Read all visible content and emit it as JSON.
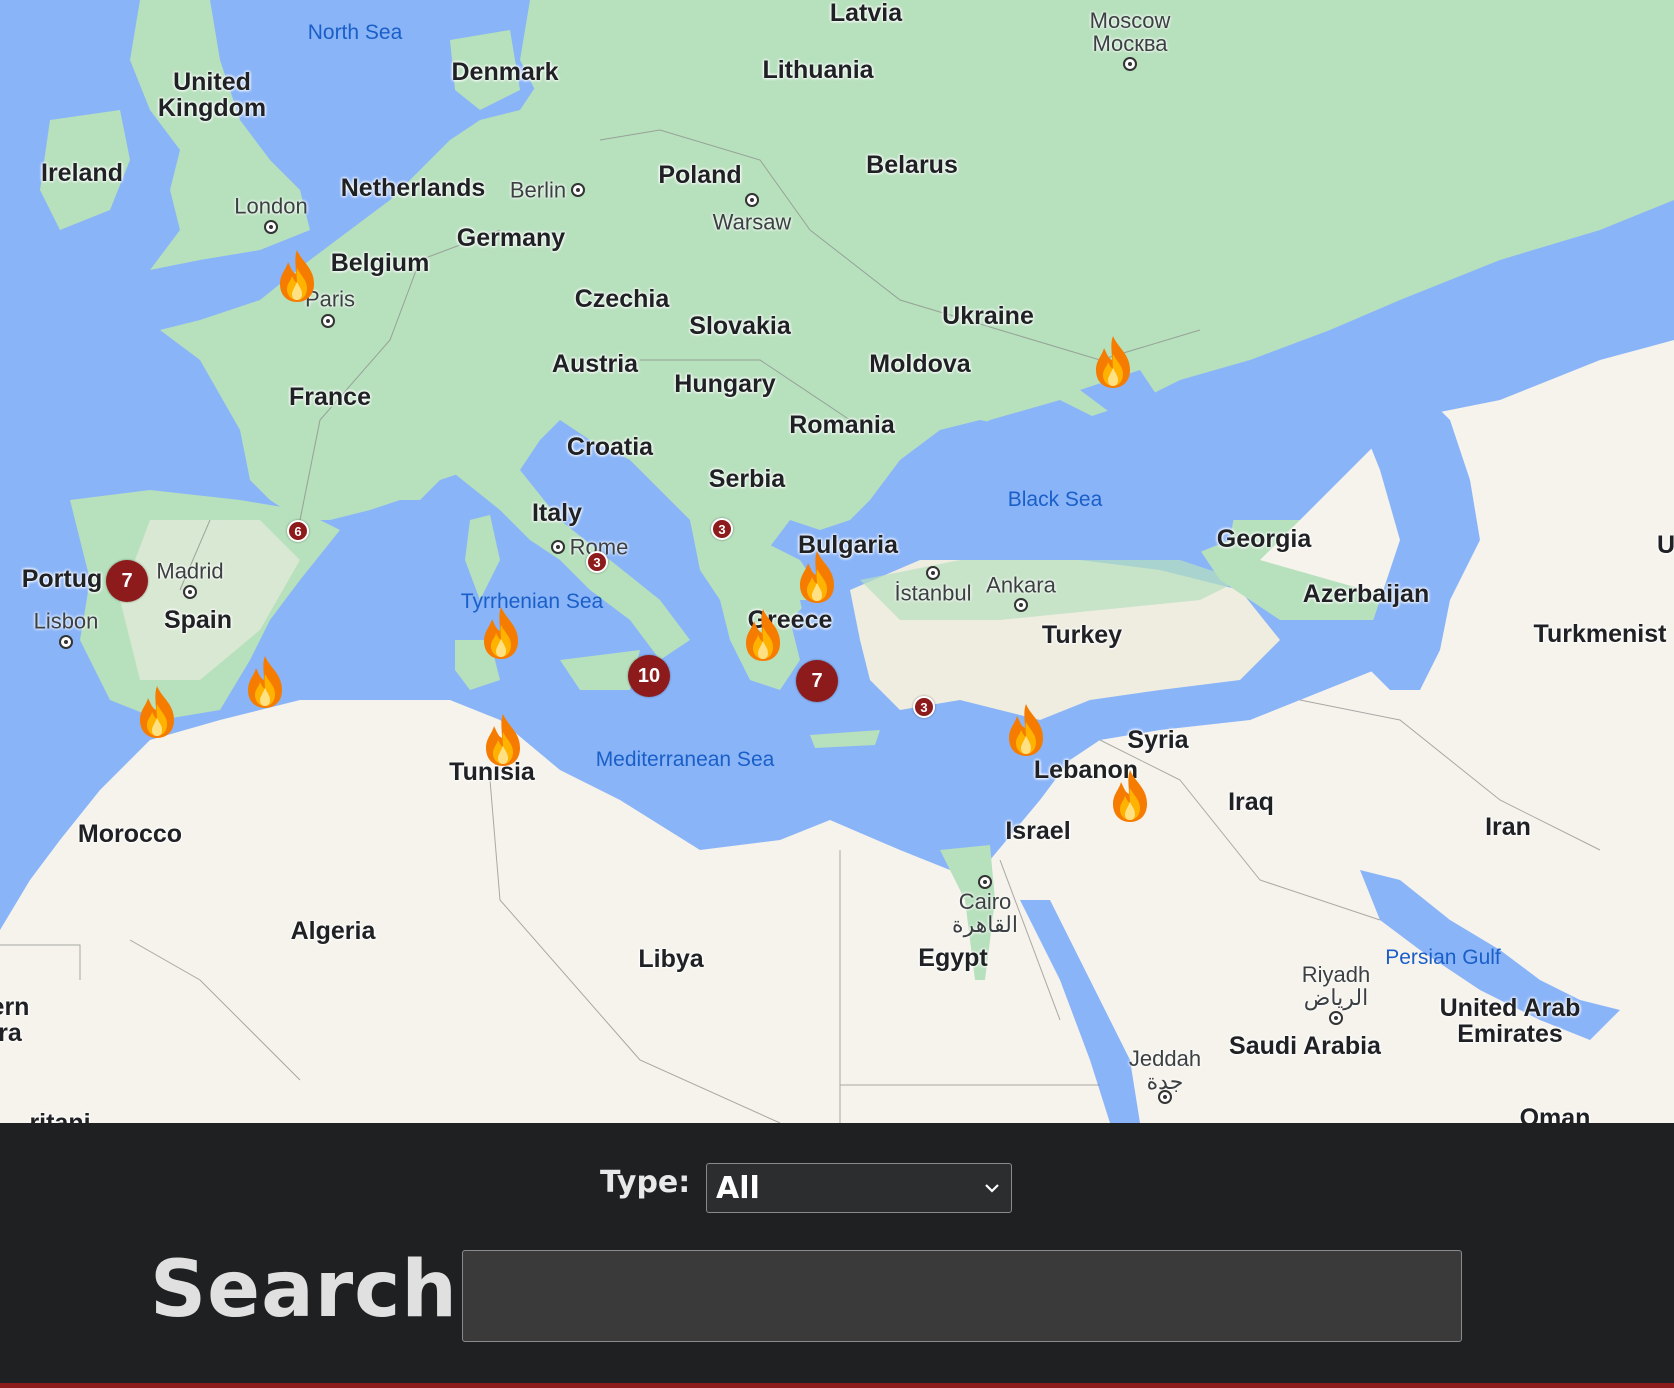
{
  "map": {
    "countries": [
      {
        "id": "united-kingdom",
        "text": "United\nKingdom"
      },
      {
        "id": "ireland",
        "text": "Ireland"
      },
      {
        "id": "denmark",
        "text": "Denmark"
      },
      {
        "id": "latvia",
        "text": "Latvia"
      },
      {
        "id": "lithuania",
        "text": "Lithuania"
      },
      {
        "id": "netherlands",
        "text": "Netherlands"
      },
      {
        "id": "poland",
        "text": "Poland"
      },
      {
        "id": "belarus",
        "text": "Belarus"
      },
      {
        "id": "belgium",
        "text": "Belgium"
      },
      {
        "id": "germany",
        "text": "Germany"
      },
      {
        "id": "czechia",
        "text": "Czechia"
      },
      {
        "id": "slovakia",
        "text": "Slovakia"
      },
      {
        "id": "ukraine",
        "text": "Ukraine"
      },
      {
        "id": "austria",
        "text": "Austria"
      },
      {
        "id": "hungary",
        "text": "Hungary"
      },
      {
        "id": "moldova",
        "text": "Moldova"
      },
      {
        "id": "france",
        "text": "France"
      },
      {
        "id": "romania",
        "text": "Romania"
      },
      {
        "id": "croatia",
        "text": "Croatia"
      },
      {
        "id": "serbia",
        "text": "Serbia"
      },
      {
        "id": "italy",
        "text": "Italy"
      },
      {
        "id": "bulgaria",
        "text": "Bulgaria"
      },
      {
        "id": "georgia",
        "text": "Georgia"
      },
      {
        "id": "portugal",
        "text": "Portug"
      },
      {
        "id": "spain",
        "text": "Spain"
      },
      {
        "id": "azerbaijan",
        "text": "Azerbaijan"
      },
      {
        "id": "greece",
        "text": "Greece"
      },
      {
        "id": "turkey",
        "text": "Turkey"
      },
      {
        "id": "turkmenistan",
        "text": "Turkmenist"
      },
      {
        "id": "syria",
        "text": "Syria"
      },
      {
        "id": "tunisia",
        "text": "Tunisia"
      },
      {
        "id": "lebanon",
        "text": "Lebanon"
      },
      {
        "id": "iraq",
        "text": "Iraq"
      },
      {
        "id": "morocco",
        "text": "Morocco"
      },
      {
        "id": "israel",
        "text": "Israel"
      },
      {
        "id": "iran",
        "text": "Iran"
      },
      {
        "id": "algeria",
        "text": "Algeria"
      },
      {
        "id": "libya",
        "text": "Libya"
      },
      {
        "id": "egypt",
        "text": "Egypt"
      },
      {
        "id": "saudi-arabia",
        "text": "Saudi Arabia"
      },
      {
        "id": "uae",
        "text": "United Arab\nEmirates"
      },
      {
        "id": "oman",
        "text": "Oman"
      },
      {
        "id": "western-sahara",
        "text": "ern\nra"
      },
      {
        "id": "uzbekistan-edge",
        "text": "U"
      },
      {
        "id": "mauritania-edge",
        "text": "ritani"
      }
    ],
    "cities": [
      {
        "id": "moscow",
        "text": "Moscow\nМосква"
      },
      {
        "id": "london",
        "text": "London"
      },
      {
        "id": "berlin",
        "text": "Berlin"
      },
      {
        "id": "warsaw",
        "text": "Warsaw"
      },
      {
        "id": "paris",
        "text": "Paris"
      },
      {
        "id": "madrid",
        "text": "Madrid"
      },
      {
        "id": "lisbon",
        "text": "Lisbon"
      },
      {
        "id": "rome",
        "text": "Rome"
      },
      {
        "id": "istanbul",
        "text": "İstanbul"
      },
      {
        "id": "ankara",
        "text": "Ankara"
      },
      {
        "id": "cairo",
        "text": "Cairo\nالقاهرة"
      },
      {
        "id": "riyadh",
        "text": "Riyadh\nالرياض"
      },
      {
        "id": "jeddah",
        "text": "Jeddah\nجدة"
      }
    ],
    "waters": [
      {
        "id": "north-sea",
        "text": "North Sea"
      },
      {
        "id": "black-sea",
        "text": "Black Sea"
      },
      {
        "id": "tyrrhenian-sea",
        "text": "Tyrrhenian Sea"
      },
      {
        "id": "mediterranean-sea",
        "text": "Mediterranean Sea"
      },
      {
        "id": "persian-gulf",
        "text": "Persian Gulf"
      }
    ],
    "fire_icon": "fire-icon",
    "fire_count": 12,
    "clusters": [
      {
        "id": "portugal-cluster",
        "count": "7",
        "size": "big"
      },
      {
        "id": "sicily-cluster",
        "count": "10",
        "size": "big"
      },
      {
        "id": "greece-cluster",
        "count": "7",
        "size": "big"
      },
      {
        "id": "france-cluster",
        "count": "6",
        "size": "small"
      },
      {
        "id": "rome-cluster",
        "count": "3",
        "size": "small"
      },
      {
        "id": "albania-cluster",
        "count": "3",
        "size": "small"
      },
      {
        "id": "turkey-cluster",
        "count": "3",
        "size": "small"
      }
    ],
    "colors": {
      "water": "#8ab4f8",
      "land_green": "#b7e0bd",
      "land_pale": "#f6f3ec",
      "cluster": "#8e1b1b"
    }
  },
  "filters": {
    "type_label": "Type:",
    "type_selected": "All"
  },
  "search": {
    "label": "Search",
    "value": "",
    "placeholder": ""
  }
}
